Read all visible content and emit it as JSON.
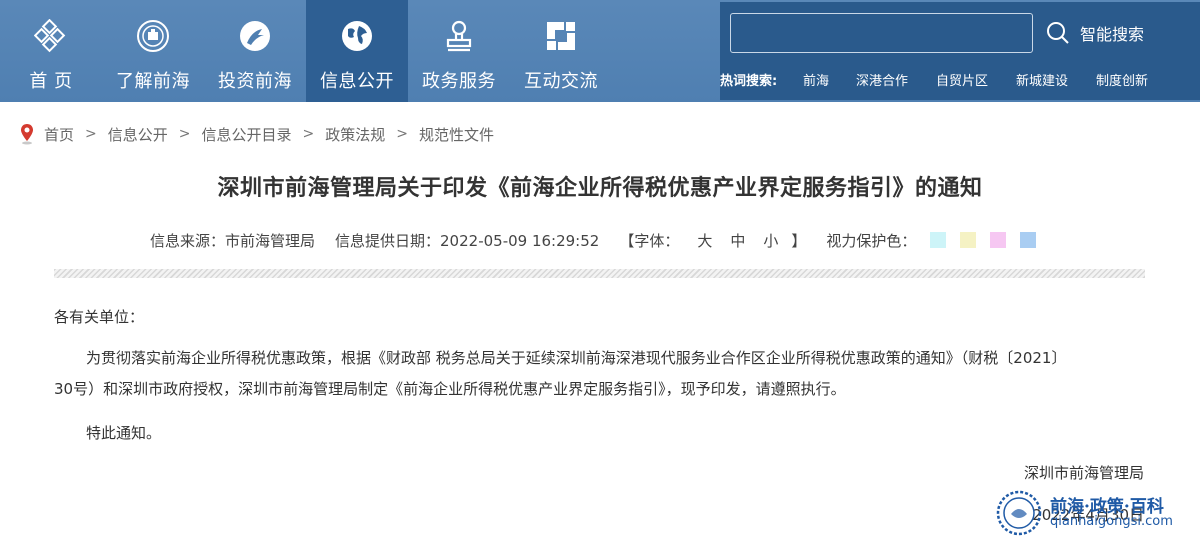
{
  "nav": {
    "items": [
      {
        "label": "首 页",
        "icon": "home-diamond-icon"
      },
      {
        "label": "了解前海",
        "icon": "emblem-icon"
      },
      {
        "label": "投资前海",
        "icon": "arrow-circle-icon"
      },
      {
        "label": "信息公开",
        "icon": "globe-icon",
        "active": true
      },
      {
        "label": "政务服务",
        "icon": "stamp-icon"
      },
      {
        "label": "互动交流",
        "icon": "interlock-icon"
      }
    ]
  },
  "search": {
    "value": "",
    "button_label": "智能搜索",
    "hot_label": "热词搜索:",
    "hot_words": [
      "前海",
      "深港合作",
      "自贸片区",
      "新城建设",
      "制度创新"
    ]
  },
  "breadcrumb": [
    "首页",
    "信息公开",
    "信息公开目录",
    "政策法规",
    "规范性文件"
  ],
  "article": {
    "title": "深圳市前海管理局关于印发《前海企业所得税优惠产业界定服务指引》的通知",
    "source": "信息来源：市前海管理局",
    "date": "信息提供日期：2022-05-09 16:29:52",
    "font_open": "【字体：",
    "font_sizes": [
      "大",
      "中",
      "小"
    ],
    "font_close": "】",
    "eye_label": "视力保护色：",
    "eye_colors": [
      "#cdf4f8",
      "#f5f2c4",
      "#f6c7f2",
      "#a9cdf2"
    ],
    "salutation": "各有关单位：",
    "para1_line1": "为贯彻落实前海企业所得税优惠政策，根据《财政部 税务总局关于延续深圳前海深港现代服务业合作区企业所得税优惠政策的通知》（财税〔2021〕",
    "para1_line2": "30号）和深圳市政府授权，深圳市前海管理局制定《前海企业所得税优惠产业界定服务指引》，现予印发，请遵照执行。",
    "para2": "特此通知。",
    "signature": "深圳市前海管理局",
    "sign_date": "2022年4月30日"
  },
  "watermark": {
    "cn": "前海·政策·百科",
    "en": "qianhaigongsi.com"
  }
}
